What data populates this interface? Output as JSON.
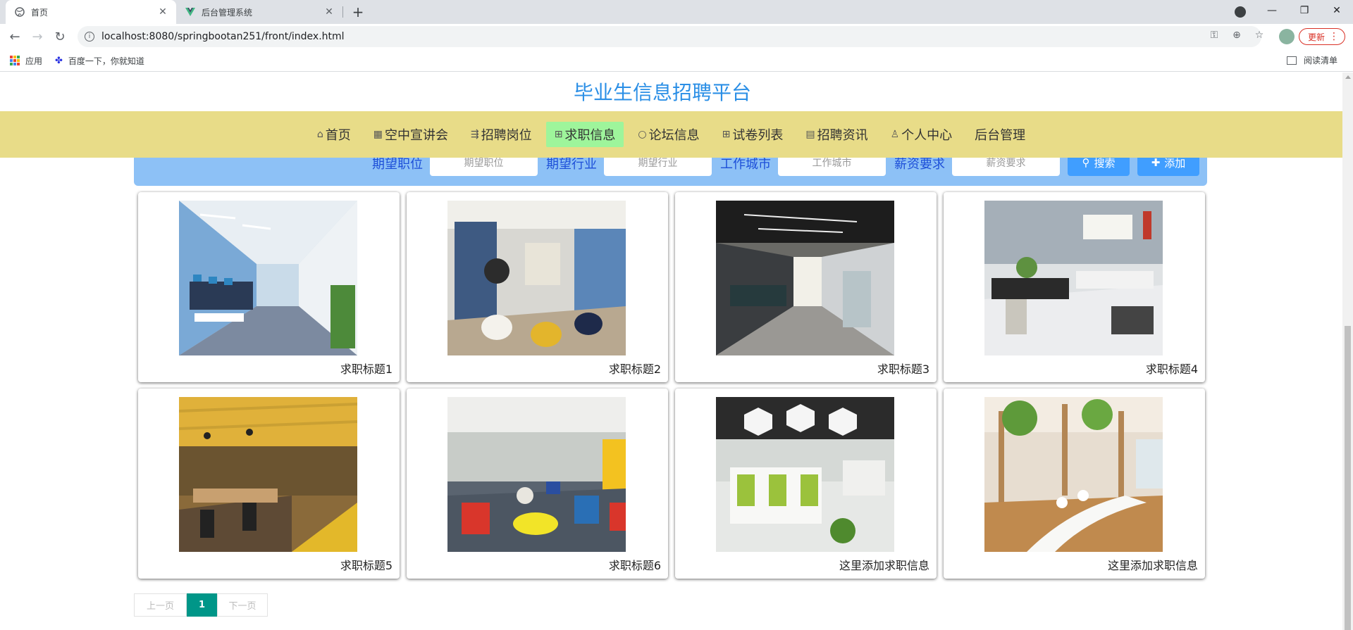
{
  "browser": {
    "tabs": [
      {
        "title": "首页",
        "active": true,
        "icon": "globe-icon"
      },
      {
        "title": "后台管理系统",
        "active": false,
        "icon": "vue-logo-icon"
      }
    ],
    "url": "localhost:8080/springbootan251/front/index.html",
    "update_label": "更新",
    "bookmarks": [
      {
        "label": "应用",
        "icon": "apps-grid-icon"
      },
      {
        "label": "百度一下，你就知道",
        "icon": "baidu-paw-icon"
      }
    ],
    "reading_list_label": "阅读清单"
  },
  "site": {
    "title": "毕业生信息招聘平台",
    "nav": [
      {
        "label": "首页",
        "icon": "⌂",
        "active": false
      },
      {
        "label": "空中宣讲会",
        "icon": "▦",
        "active": false
      },
      {
        "label": "招聘岗位",
        "icon": "⇶",
        "active": false
      },
      {
        "label": "求职信息",
        "icon": "⊞",
        "active": true
      },
      {
        "label": "论坛信息",
        "icon": "○",
        "active": false
      },
      {
        "label": "试卷列表",
        "icon": "⊞",
        "active": false
      },
      {
        "label": "招聘资讯",
        "icon": "▤",
        "active": false
      },
      {
        "label": "个人中心",
        "icon": "♙",
        "active": false
      },
      {
        "label": "后台管理",
        "icon": "",
        "active": false
      }
    ],
    "search": {
      "fields": [
        {
          "label": "期望职位",
          "placeholder": "期望职位"
        },
        {
          "label": "期望行业",
          "placeholder": "期望行业"
        },
        {
          "label": "工作城市",
          "placeholder": "工作城市"
        },
        {
          "label": "薪资要求",
          "placeholder": "薪资要求"
        }
      ],
      "search_label": "搜索",
      "add_label": "添加"
    },
    "cards": [
      {
        "caption": "求职标题1",
        "scene": "office-corridor-blue"
      },
      {
        "caption": "求职标题2",
        "scene": "lounge-modern"
      },
      {
        "caption": "求职标题3",
        "scene": "office-dark-corridor"
      },
      {
        "caption": "求职标题4",
        "scene": "office-white-desks"
      },
      {
        "caption": "求职标题5",
        "scene": "office-yellow-wood"
      },
      {
        "caption": "求职标题6",
        "scene": "colorful-lounge"
      },
      {
        "caption": "这里添加求职信息",
        "scene": "office-green-cubicles"
      },
      {
        "caption": "这里添加求职信息",
        "scene": "cafe-wood-trees"
      }
    ],
    "pager": {
      "prev": "上一页",
      "current": "1",
      "next": "下一页"
    }
  },
  "colors": {
    "title": "#2b8fe6",
    "navbar": "#e8dc88",
    "nav_active": "#9ef59b",
    "search_bg": "#8dc1f6",
    "search_label": "#1d4fd8",
    "button": "#409eff",
    "pager_active": "#009688"
  }
}
